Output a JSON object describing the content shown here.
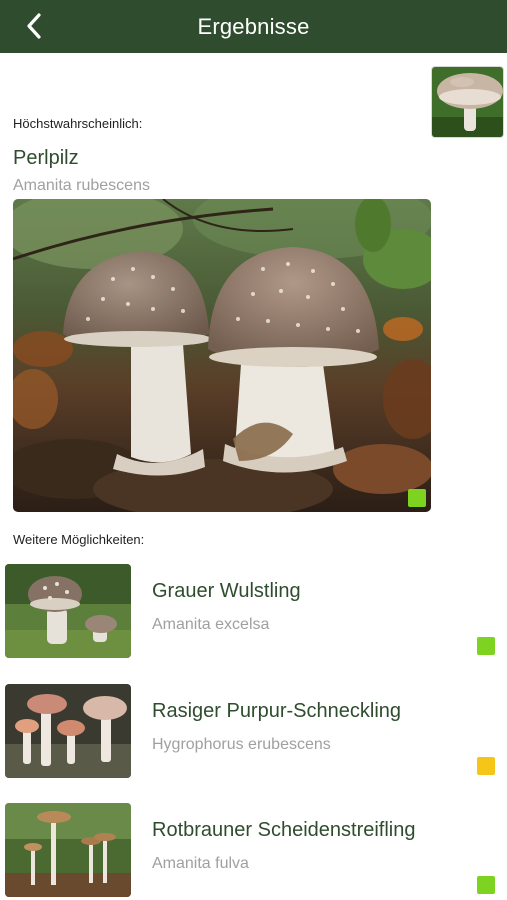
{
  "header": {
    "title": "Ergebnisse"
  },
  "top_match": {
    "label": "Höchstwahrscheinlich:",
    "name": "Perlpilz",
    "latin": "Amanita rubescens",
    "status_color": "#7ed321"
  },
  "more": {
    "label": "Weitere Möglichkeiten:",
    "items": [
      {
        "name": "Grauer Wulstling",
        "latin": "Amanita excelsa",
        "status_color": "#7ed321"
      },
      {
        "name": "Rasiger Purpur-Schneckling",
        "latin": "Hygrophorus erubescens",
        "status_color": "#f5c518"
      },
      {
        "name": "Rotbrauner Scheidenstreifling",
        "latin": "Amanita fulva",
        "status_color": "#7ed321"
      }
    ]
  },
  "icons": {
    "back": "chevron-left-icon"
  }
}
